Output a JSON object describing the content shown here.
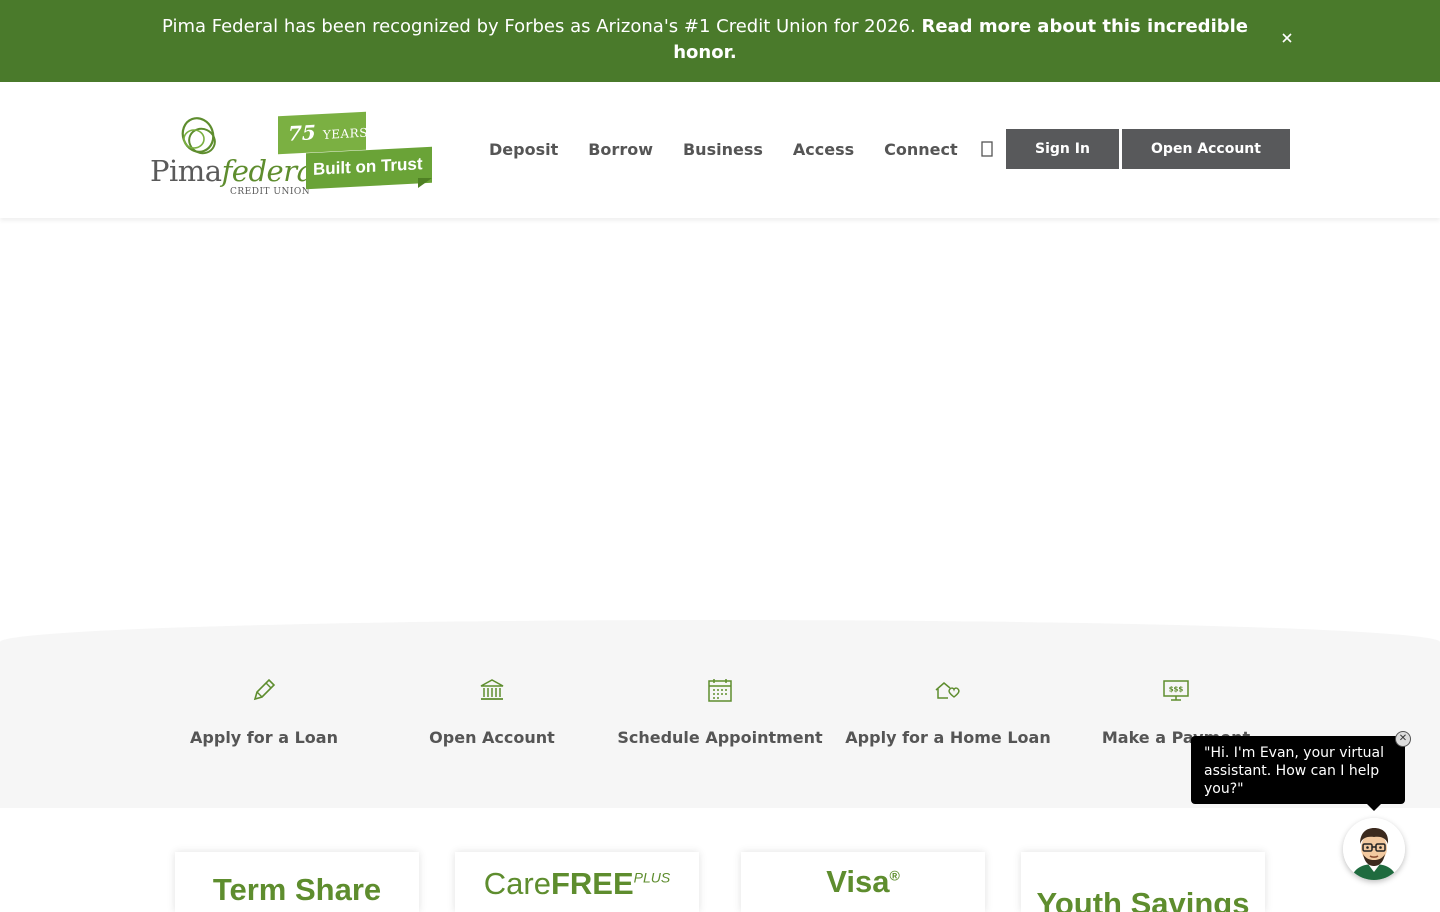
{
  "banner": {
    "text": "Pima Federal has been recognized by Forbes as Arizona's #1 Credit Union for 2026. ",
    "link": "Read more about this incredible honor.",
    "close_icon": "close-icon"
  },
  "logo": {
    "name_plain": "Pima",
    "name_italic": "federal",
    "subtitle": "CREDIT UNION",
    "badge_number": "75",
    "badge_years": "YEARS",
    "badge_tagline": "Built on Trust"
  },
  "nav": {
    "items": [
      "Deposit",
      "Borrow",
      "Business",
      "Access",
      "Connect"
    ],
    "search_icon": "search-icon"
  },
  "buttons": {
    "sign_in": "Sign In",
    "open_account": "Open Account"
  },
  "quick_links": [
    {
      "label": "Apply for a Loan",
      "icon": "pencil-icon"
    },
    {
      "label": "Open Account",
      "icon": "bank-icon"
    },
    {
      "label": "Schedule Appointment",
      "icon": "calendar-icon"
    },
    {
      "label": "Apply for a Home Loan",
      "icon": "house-heart-icon"
    },
    {
      "label": "Make a Payment",
      "icon": "payment-monitor-icon"
    }
  ],
  "cards": [
    {
      "title": "Term Share",
      "sup": ""
    },
    {
      "title": "Care",
      "title_bold": "FREE",
      "sup": "PLUS"
    },
    {
      "title": "Visa",
      "sup": "®"
    },
    {
      "title": "Youth Savings",
      "sup": ""
    }
  ],
  "chat": {
    "message": "\"Hi. I'm Evan, your virtual assistant. How can I help you?\"",
    "avatar_icon": "assistant-avatar-icon"
  },
  "colors": {
    "banner_green": "#4a7a2b",
    "brand_green": "#5e8d2e",
    "button_gray": "#58595b"
  }
}
